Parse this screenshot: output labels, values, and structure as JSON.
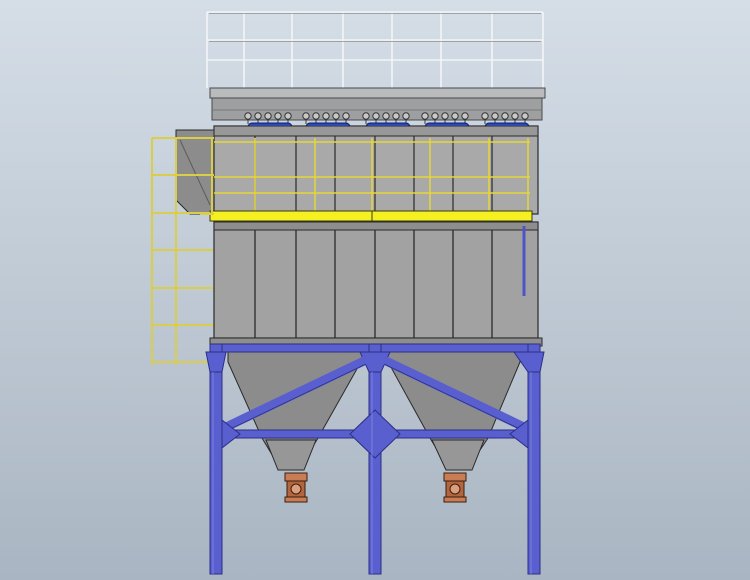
{
  "colors": {
    "background_top": "#d4dde6",
    "background_bottom": "#aab6c3",
    "railing": "#eef0f2",
    "roof": "#9e9e9e",
    "housing": "#a4a4a4",
    "housing_dark": "#7f7f7f",
    "panel_line": "#2a2a2a",
    "hopper": "#8d8d8d",
    "walkway_yellow": "#f2ee22",
    "stair_yellow": "#e7d94f",
    "support_blue": "#5a5fd0",
    "support_blue_dark": "#3e43a8",
    "pulse_valve_blue": "#2447d8",
    "outlet_valve": "#b7653f"
  },
  "components": {
    "top_railing": "railing-icon",
    "roof_cap": "roof-icon",
    "pulse_valves": "valve-icon",
    "upper_housing": "housing-icon",
    "walkway": "walkway-icon",
    "side_ladder": "ladder-icon",
    "lower_housing": "housing-icon",
    "hoppers": "hopper-icon",
    "support_structure": "support-frame-icon",
    "rotary_valves": "rotary-valve-icon"
  }
}
